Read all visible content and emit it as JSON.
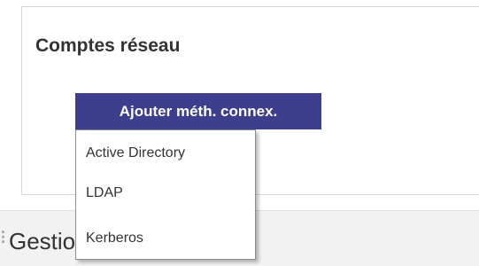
{
  "panel": {
    "title": "Comptes réseau"
  },
  "add_button": {
    "label": "Ajouter méth. connex."
  },
  "dropdown": {
    "items": [
      {
        "label": "Active Directory"
      },
      {
        "label": "LDAP"
      },
      {
        "label": "Kerberos"
      }
    ]
  },
  "section": {
    "title": "Gestionnaire de compte"
  },
  "colors": {
    "button_background": "#3d3f8e",
    "button_text": "#ffffff",
    "panel_border": "#d6d6d6",
    "section_background": "#f2f2f2"
  }
}
